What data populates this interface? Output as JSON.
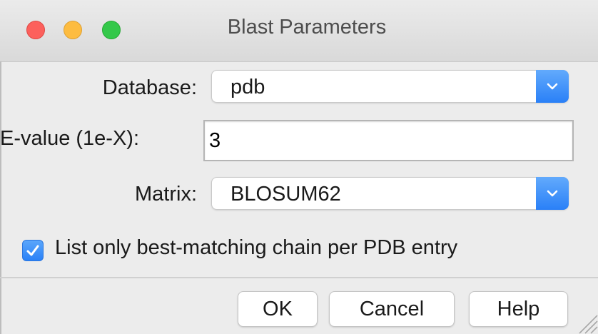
{
  "window": {
    "title": "Blast Parameters"
  },
  "form": {
    "database_label": "Database:",
    "database_value": "pdb",
    "evalue_label": "E-value (1e-X):",
    "evalue_value": "3",
    "matrix_label": "Matrix:",
    "matrix_value": "BLOSUM62",
    "best_chain_label": "List only best-matching chain per PDB entry",
    "best_chain_checked": true
  },
  "buttons": {
    "ok": "OK",
    "cancel": "Cancel",
    "help": "Help"
  },
  "colors": {
    "close": "#fc605c",
    "minimize": "#fdbc40",
    "maximize": "#34c84a",
    "accent": "#2a80f7"
  },
  "icons": {
    "popup_arrow": "chevron-down-icon",
    "check": "checkmark-icon",
    "resize": "resize-grip-icon"
  }
}
